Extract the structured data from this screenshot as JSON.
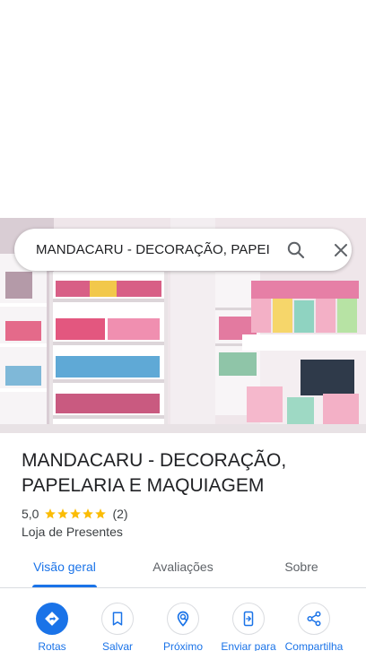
{
  "search": {
    "query": "MANDACARU - DECORAÇÃO, PAPEI"
  },
  "place": {
    "name": "MANDACARU - DECORAÇÃO, PAPELARIA E MAQUIAGEM",
    "rating": "5,0",
    "stars": 5,
    "review_count": "(2)",
    "category": "Loja de Presentes"
  },
  "tabs": [
    {
      "label": "Visão geral",
      "active": true
    },
    {
      "label": "Avaliações",
      "active": false
    },
    {
      "label": "Sobre",
      "active": false
    }
  ],
  "actions": [
    {
      "label": "Rotas",
      "icon": "directions-icon"
    },
    {
      "label": "Salvar",
      "icon": "bookmark-icon"
    },
    {
      "label": "Próximo",
      "icon": "nearby-icon"
    },
    {
      "label": "Enviar para",
      "icon": "send-to-phone-icon"
    },
    {
      "label": "Compartilha",
      "icon": "share-icon"
    }
  ],
  "colors": {
    "accent": "#1a73e8",
    "star": "#fbbc04",
    "text_primary": "#202124",
    "text_secondary": "#3c4043"
  }
}
